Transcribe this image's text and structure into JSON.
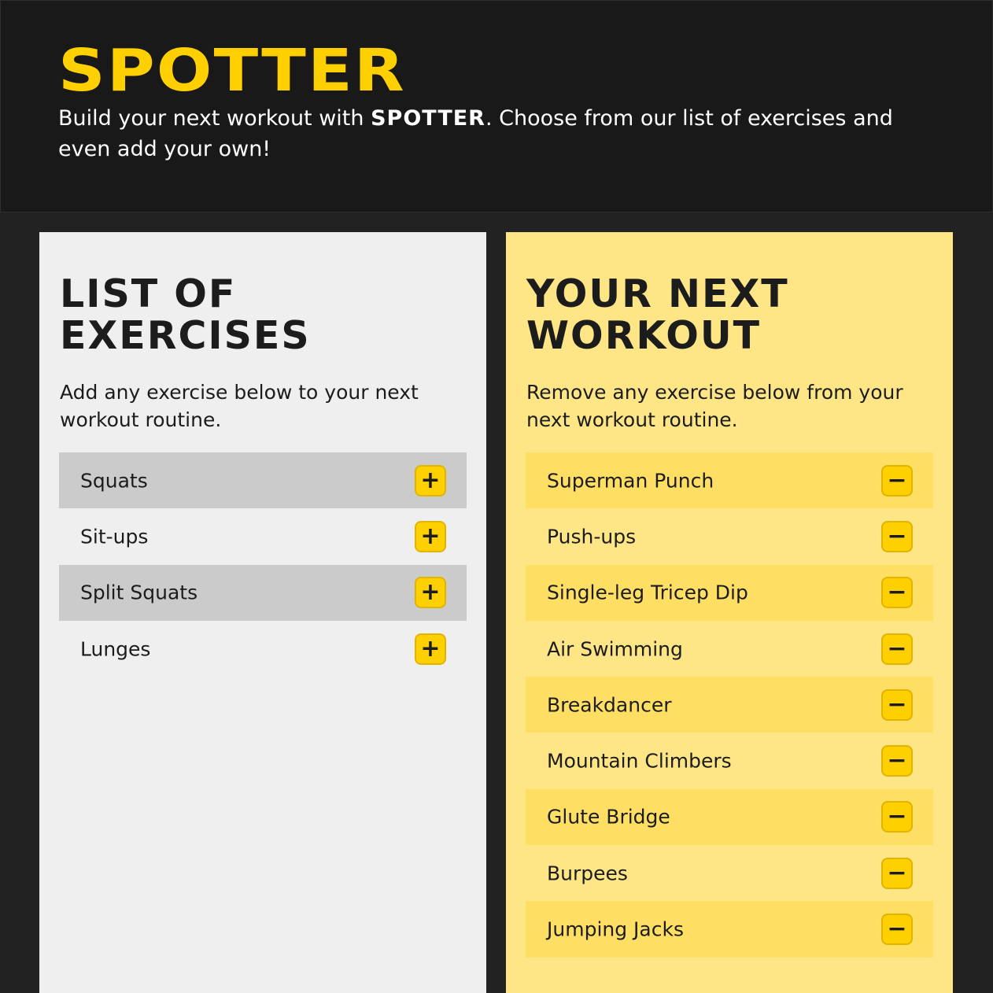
{
  "header": {
    "logo": "SPOTTER",
    "tagline_before": "Build your next workout with ",
    "tagline_brand": "SPOTTER",
    "tagline_after": ". Choose from our list of exercises and even add your own!"
  },
  "exercises": {
    "title_line1": "LIST OF",
    "title_line2": "EXERCISES",
    "description": "Add any exercise below to your next workout routine.",
    "add_icon": "plus-icon",
    "items": [
      {
        "label": "Squats",
        "action": "+"
      },
      {
        "label": "Sit-ups",
        "action": "+"
      },
      {
        "label": "Split Squats",
        "action": "+"
      },
      {
        "label": "Lunges",
        "action": "+"
      }
    ]
  },
  "workout": {
    "title_line1": "YOUR NEXT",
    "title_line2": "WORKOUT",
    "description": "Remove any exercise below from your next workout routine.",
    "remove_icon": "minus-icon",
    "items": [
      {
        "label": "Superman Punch",
        "action": "−"
      },
      {
        "label": "Push-ups",
        "action": "−"
      },
      {
        "label": "Single-leg Tricep Dip",
        "action": "−"
      },
      {
        "label": "Air Swimming",
        "action": "−"
      },
      {
        "label": "Breakdancer",
        "action": "−"
      },
      {
        "label": "Mountain Climbers",
        "action": "−"
      },
      {
        "label": "Glute Bridge",
        "action": "−"
      },
      {
        "label": "Burpees",
        "action": "−"
      },
      {
        "label": "Jumping Jacks",
        "action": "−"
      }
    ]
  },
  "colors": {
    "brand_yellow": "#ffd000",
    "header_bg": "#191919",
    "page_bg": "#222222",
    "left_panel_bg": "#efefef",
    "left_row_alt": "#cbcbcb",
    "right_panel_bg": "#fee687",
    "right_row_alt": "#ffdf63",
    "text_dark": "#1c1c1c"
  }
}
